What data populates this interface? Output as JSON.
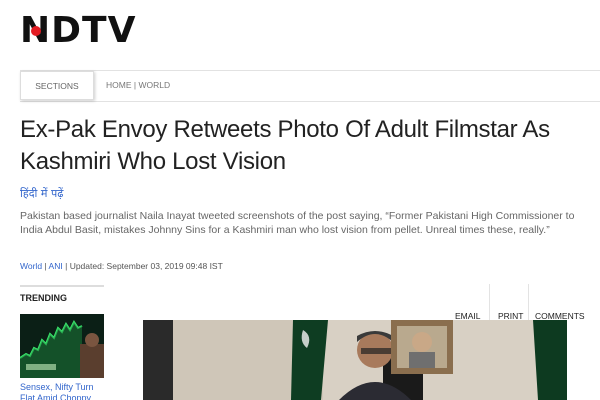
{
  "logo": {
    "text_n": "N",
    "text_tv": "TV",
    "dot_color": "#e31c23"
  },
  "nav": {
    "sections_label": "SECTIONS",
    "breadcrumb": [
      "HOME",
      "WORLD"
    ],
    "breadcrumb_sep": "|"
  },
  "article": {
    "title": "Ex-Pak Envoy Retweets Photo Of Adult Filmstar As Kashmiri Who Lost Vision",
    "hindi_link": "हिंदी में पढ़ें",
    "summary": "Pakistan based journalist Naila Inayat tweeted screenshots of the post saying, “Former Pakistani High Commissioner to India Abdul Basit, mistakes Johnny Sins for a Kashmiri man who lost vision from pellet. Unreal times these, really.”",
    "meta": {
      "category": "World",
      "source": "ANI",
      "sep": "|",
      "updated": "Updated: September 03, 2019 09:48 IST"
    }
  },
  "trending": {
    "label": "TRENDING",
    "items": [
      {
        "caption": "Sensex, Nifty Turn Flat Amid Choppy"
      }
    ]
  },
  "share": {
    "email": "EMAIL",
    "print": "PRINT",
    "comments": "COMMENTS"
  },
  "colors": {
    "link": "#3366cc",
    "brand_red": "#e31c23",
    "text": "#222222"
  }
}
